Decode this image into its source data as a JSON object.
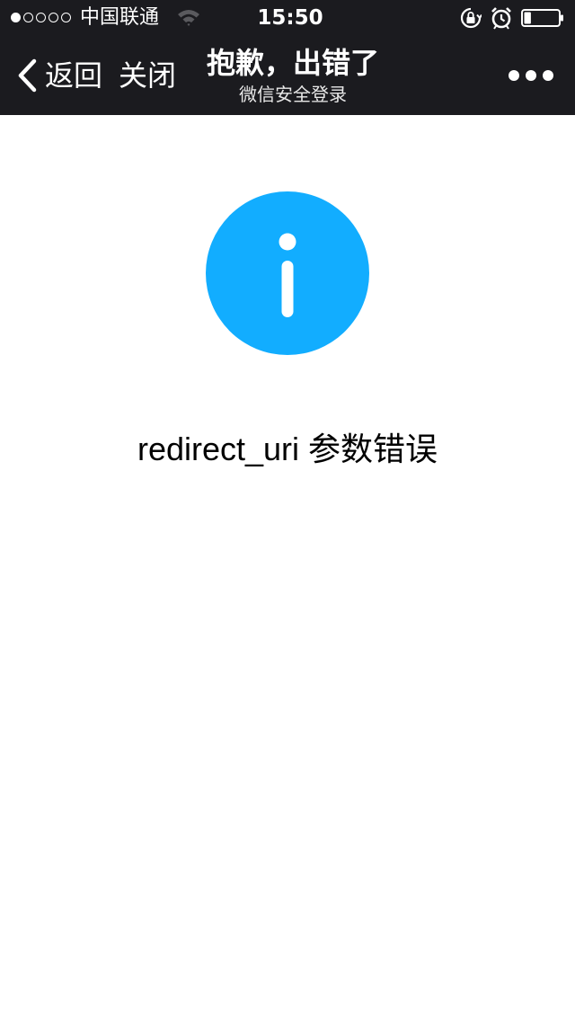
{
  "status_bar": {
    "signal_strength": 1,
    "signal_max": 5,
    "carrier": "中国联通",
    "time": "15:50",
    "battery_level": 0.2,
    "icons": [
      "wifi-icon",
      "rotation-lock-icon",
      "alarm-icon",
      "battery-icon"
    ]
  },
  "nav": {
    "back_label": "返回",
    "close_label": "关闭",
    "title": "抱歉，出错了",
    "subtitle": "微信安全登录",
    "more_icon": "more-icon"
  },
  "content": {
    "icon": "info-icon",
    "icon_color": "#12adff",
    "message": "redirect_uri 参数错误"
  },
  "colors": {
    "bar_background": "#1b1b1f",
    "page_background": "#ffffff"
  }
}
